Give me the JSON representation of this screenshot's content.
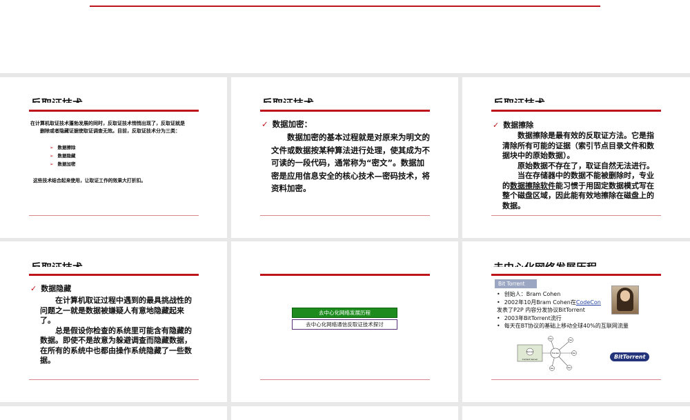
{
  "slide1": {},
  "slide2": {
    "title": "反取证技术",
    "intro_line1": "在计算机取证技术蓬勃发展的同时，反取证技术悄悄出现了，反取证就是",
    "intro_line2": "删除或者隐藏证据使取证调查无效。目前，反取证技术分为三类：",
    "list": [
      "数据擦除",
      "数据隐藏",
      "数据加密"
    ],
    "summary": "这些技术结合起来使用，让取证工作的效果大打折扣。"
  },
  "slide3": {
    "title": "反取证技术",
    "heading": "数据加密：",
    "body": "数据加密的基本过程就是对原来为明文的文件或数据按某种算法进行处理，使其成为不可读的一段代码，通常称为“密文”。数据加密是应用信息安全的核心技术—密码技术，将资料加密。"
  },
  "slide4": {
    "title": "反取证技术",
    "heading": "数据擦除",
    "para1": "数据擦除是最有效的反取证方法。它是指清除所有可能的证据（索引节点目录文件和数据块中的原始数据）。",
    "para2": "原始数据不存在了，取证自然无法进行。",
    "para3_part1": "当在存储器中的数据不能被删除时，专业的",
    "para3_link": "数据擦除软件",
    "para3_part2": "能习惯于用固定数据模式写在整个磁盘区域，因此能有效地擦除在磁盘上的数据。"
  },
  "slide5": {
    "title": "反取证技术",
    "heading": "数据隐藏",
    "para1": "在计算机取证过程中遇到的最具挑战性的问题之一就是数据被嫌疑人有意地隐藏起来了。",
    "para2": "总是假设你检查的系统里可能含有隐藏的数据。即使不是故意为躲避调查而隐藏数据，在所有的系统中也都由操作系统隐藏了一些数据。"
  },
  "slide6": {
    "button1": "去中心化网络发展历程",
    "button2": "去中心化网络通信反取证技术探讨"
  },
  "slide7": {
    "title": "去中心化网络发展历程",
    "badge": "Bit Torrent",
    "b1": "创始人：Bram Cohen",
    "b2_pre": "2002年10月Bram Cohen在",
    "b2_link": "CodeCon",
    "b2_post": "发表了P2P 内容分发协议BitTorrent",
    "b3": "2003年BitTorrent流行",
    "b4": "每天在BT协议的基础上移动全球40%的互联网流量",
    "diagram_server": "Server",
    "diagram_server_caption": "Content Server",
    "diagram_tracker": "Tracker",
    "diagram_peer": "Peer",
    "logo": "BitTorrent"
  },
  "colors": {
    "accent": "#c0141c",
    "button_green": "#1d8b1d",
    "badge": "#9aa6c2"
  }
}
